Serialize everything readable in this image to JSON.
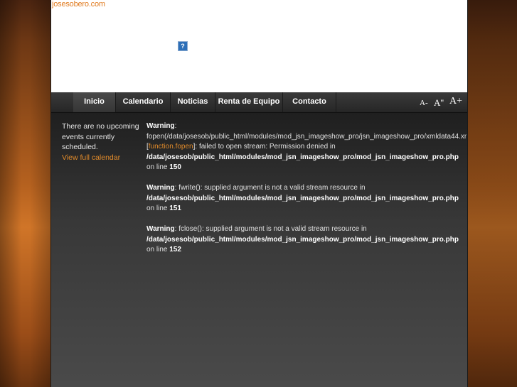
{
  "header": {
    "site_link": "josesobero.com",
    "broken_image_glyph": "?"
  },
  "nav": {
    "items": [
      {
        "label": "Inicio",
        "active": true
      },
      {
        "label": "Calendario"
      },
      {
        "label": "Noticias"
      },
      {
        "label": "Renta de Equipo"
      },
      {
        "label": "Contacto"
      }
    ]
  },
  "font_controls": {
    "decrease": "A-",
    "reset": "A''",
    "increase": "A+"
  },
  "sidebar": {
    "text_line1": "There are no upcoming",
    "text_line2": "events currently",
    "text_line3": "scheduled.",
    "calendar_link": "View full calendar"
  },
  "warnings": [
    {
      "label": "Warning",
      "line1": "fopen(/data/josesob/public_html/modules/mod_jsn_imageshow_pro/jsn_imageshow_pro/xmldata44.xm",
      "func_link": "function.fopen",
      "line2_suffix": "]: failed to open stream: Permission denied in",
      "path": "/data/josesob/public_html/modules/mod_jsn_imageshow_pro/mod_jsn_imageshow_pro.php",
      "on_line_prefix": "on line",
      "line_number": "150"
    },
    {
      "label": "Warning",
      "message": ": fwrite(): supplied argument is not a valid stream resource in",
      "path": "/data/josesob/public_html/modules/mod_jsn_imageshow_pro/mod_jsn_imageshow_pro.php",
      "on_line_prefix": "on line",
      "line_number": "151"
    },
    {
      "label": "Warning",
      "message": ": fclose(): supplied argument is not a valid stream resource in",
      "path": "/data/josesob/public_html/modules/mod_jsn_imageshow_pro/mod_jsn_imageshow_pro.php",
      "on_line_prefix": "on line",
      "line_number": "152"
    }
  ],
  "colors": {
    "accent": "#e08a2a",
    "nav_bg": "#2b2b2b",
    "content_bg": "#3a3a3a"
  }
}
